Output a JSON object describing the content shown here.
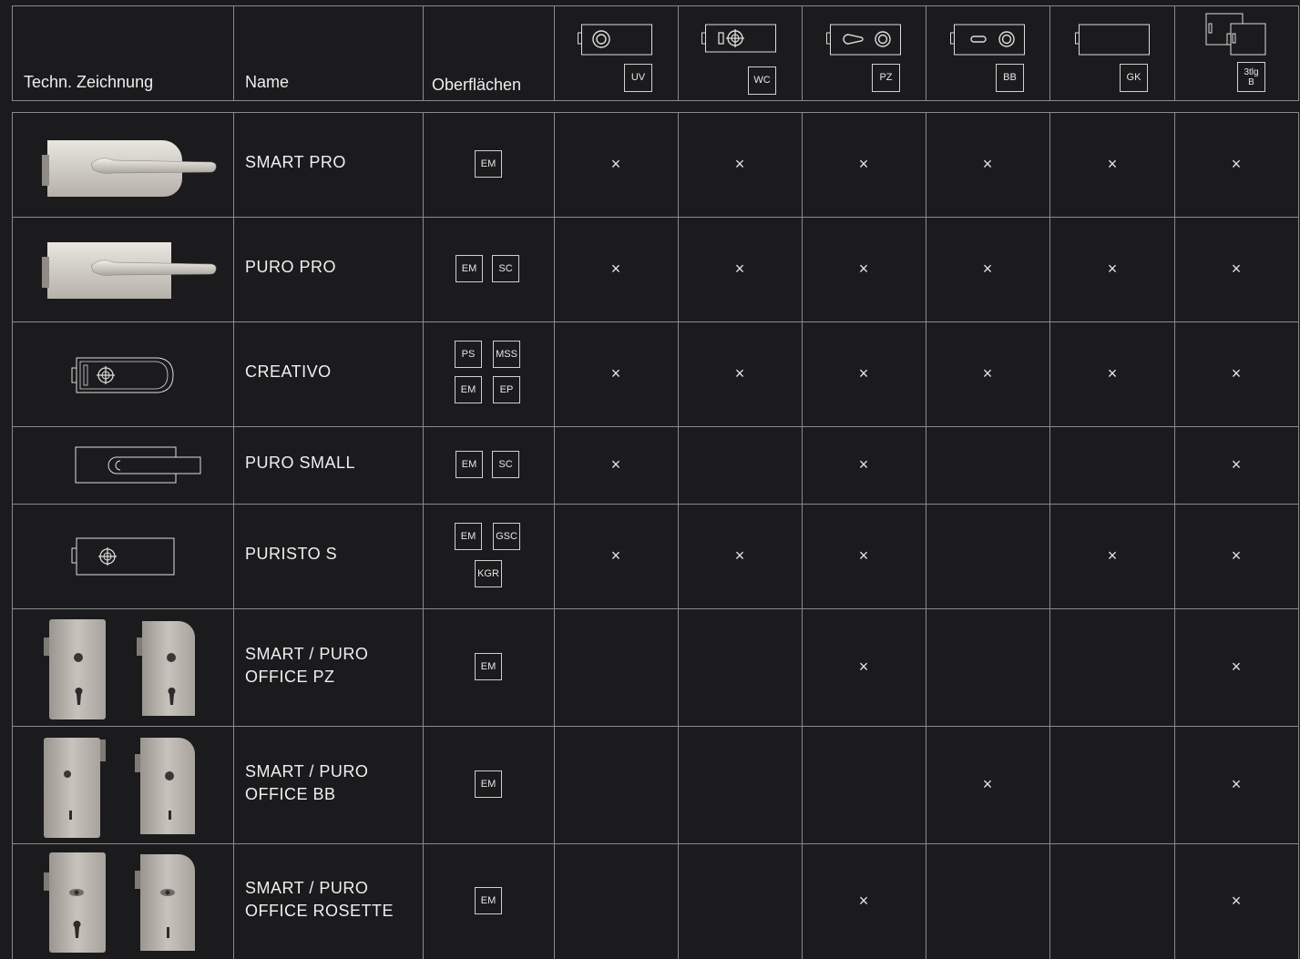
{
  "headers": {
    "drawing": "Techn. Zeichnung",
    "name": "Name",
    "finishes": "Oberflächen",
    "variants": [
      "UV",
      "WC",
      "PZ",
      "BB",
      "GK",
      "3tlg\nB"
    ]
  },
  "rows": [
    {
      "drawing_icon": "handle-lock-photo-icon",
      "name": "SMART PRO",
      "finishes": [
        "EM"
      ],
      "marks": [
        "×",
        "×",
        "×",
        "×",
        "×",
        "×"
      ]
    },
    {
      "drawing_icon": "handle-lock-photo-icon",
      "name": "PURO PRO",
      "finishes": [
        "EM",
        "SC"
      ],
      "marks": [
        "×",
        "×",
        "×",
        "×",
        "×",
        "×"
      ]
    },
    {
      "drawing_icon": "creativo-drawing-icon",
      "name": "CREATIVO",
      "finishes": [
        "PS",
        "MSS",
        "EM",
        "EP"
      ],
      "marks": [
        "×",
        "×",
        "×",
        "×",
        "×",
        "×"
      ]
    },
    {
      "drawing_icon": "puro-small-drawing-icon",
      "name": "PURO SMALL",
      "finishes": [
        "EM",
        "SC"
      ],
      "marks": [
        "×",
        "",
        "×",
        "",
        "",
        "×"
      ]
    },
    {
      "drawing_icon": "puristo-drawing-icon",
      "name": "PURISTO S",
      "finishes": [
        "EM",
        "GSC",
        "KGR"
      ],
      "marks": [
        "×",
        "×",
        "×",
        "",
        "×",
        "×"
      ]
    },
    {
      "drawing_icon": "office-lock-photo-icon",
      "name": "SMART / PURO\nOFFICE PZ",
      "finishes": [
        "EM"
      ],
      "marks": [
        "",
        "",
        "×",
        "",
        "",
        "×"
      ]
    },
    {
      "drawing_icon": "office-lock-photo-icon",
      "name": "SMART / PURO\nOFFICE BB",
      "finishes": [
        "EM"
      ],
      "marks": [
        "",
        "",
        "",
        "×",
        "",
        "×"
      ]
    },
    {
      "drawing_icon": "office-lock-photo-icon",
      "name": "SMART / PURO\nOFFICE ROSETTE",
      "finishes": [
        "EM"
      ],
      "marks": [
        "",
        "",
        "×",
        "",
        "",
        "×"
      ]
    }
  ]
}
